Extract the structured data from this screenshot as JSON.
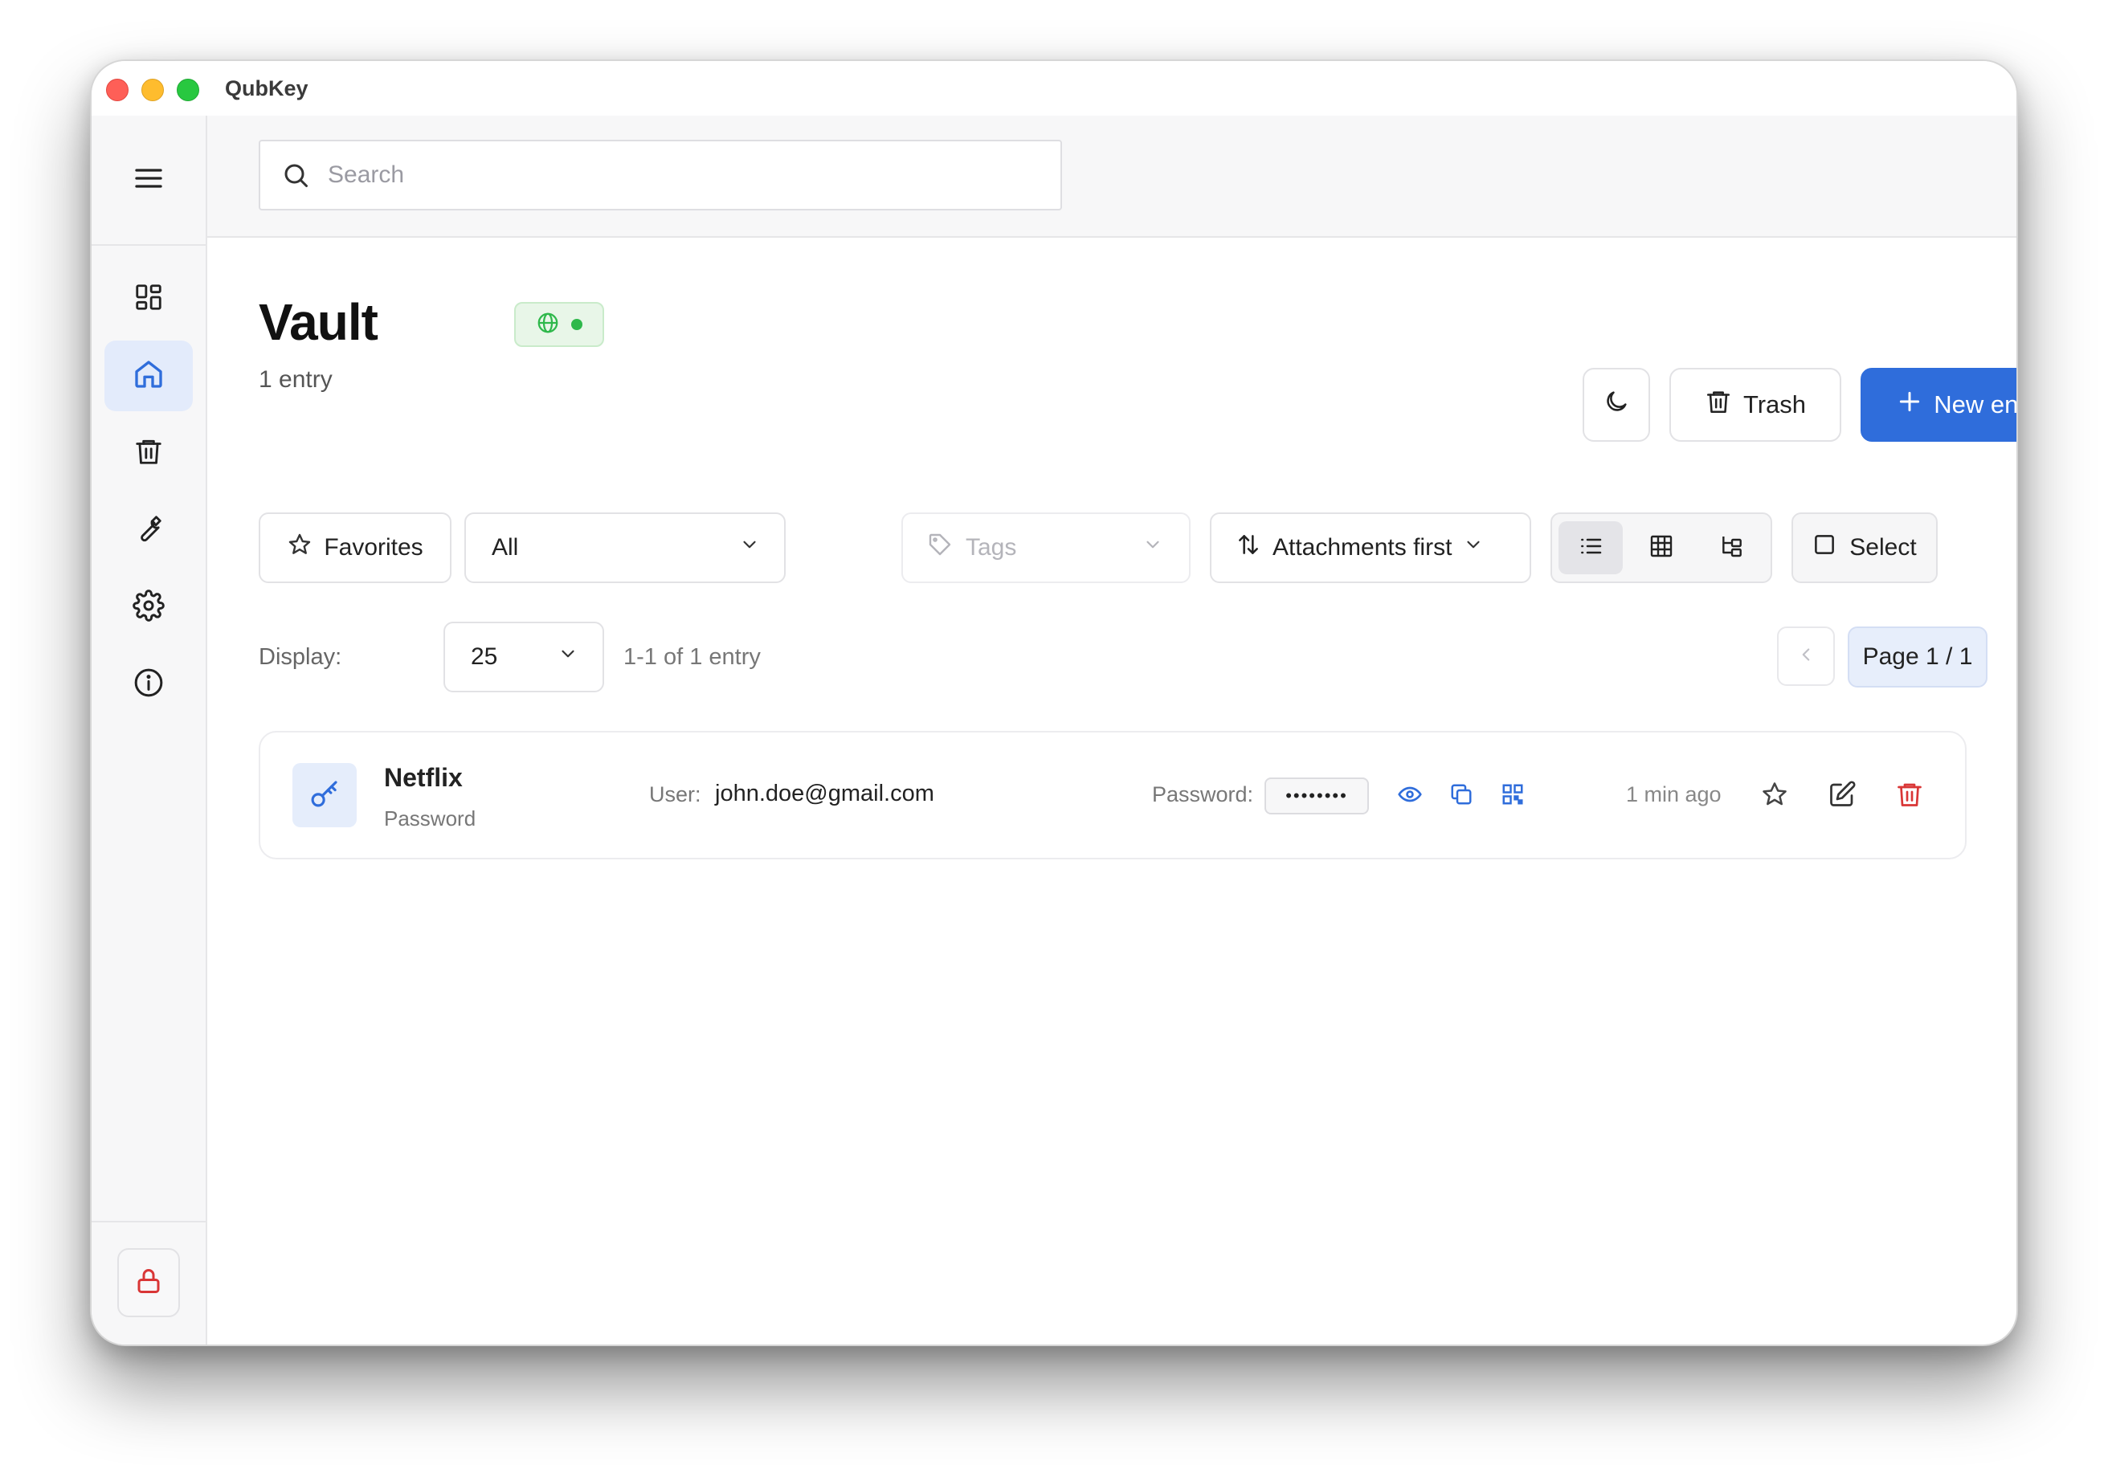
{
  "app": {
    "title": "QubKey"
  },
  "search": {
    "placeholder": "Search"
  },
  "sidebar": {
    "items": [
      {
        "name": "dashboard",
        "icon": "grid-icon",
        "active": false
      },
      {
        "name": "home",
        "icon": "home-icon",
        "active": true
      },
      {
        "name": "trash",
        "icon": "trash-icon",
        "active": false
      },
      {
        "name": "tools",
        "icon": "wrench-icon",
        "active": false
      },
      {
        "name": "settings",
        "icon": "gear-icon",
        "active": false
      },
      {
        "name": "about",
        "icon": "info-icon",
        "active": false
      }
    ],
    "lock_icon": "lock-icon"
  },
  "header": {
    "title": "Vault",
    "subtitle": "1 entry",
    "trash_label": "Trash",
    "new_entry_label": "New entry"
  },
  "filters": {
    "favorites_label": "Favorites",
    "category_value": "All",
    "tags_placeholder": "Tags",
    "sort_label": "Attachments first",
    "select_label": "Select",
    "active_view": "list"
  },
  "pagination": {
    "display_label": "Display:",
    "page_size": "25",
    "range_text": "1-1 of 1 entry",
    "page_label": "Page 1 / 1"
  },
  "entries": [
    {
      "name": "Netflix",
      "type": "Password",
      "user_label": "User:",
      "user": "john.doe@gmail.com",
      "password_label": "Password:",
      "password_mask": "••••••••",
      "updated": "1 min ago"
    }
  ],
  "colors": {
    "accent": "#2f6ddb",
    "danger": "#d93636",
    "online": "#2eb84b"
  }
}
